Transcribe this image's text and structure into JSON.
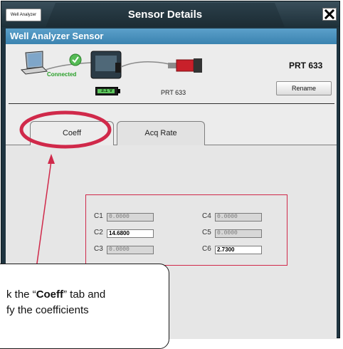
{
  "window": {
    "app_chip": "Well Analyzer",
    "title": "Sensor Details",
    "close_glyph": "✕"
  },
  "header": {
    "title": "Well Analyzer Sensor"
  },
  "devices": {
    "icons": [
      "laptop-icon",
      "check-icon",
      "analyzer-case-icon",
      "sensor-probe-icon"
    ],
    "status": "Connected",
    "battery": "3.1 V",
    "sensor_caption": "PRT 633"
  },
  "sensor": {
    "name": "PRT 633",
    "rename_label": "Rename"
  },
  "tabs": [
    {
      "label": "Coeff",
      "selected": true
    },
    {
      "label": "Acq Rate",
      "selected": false
    }
  ],
  "coefficients": [
    {
      "label": "C1",
      "value": "0.0000",
      "editable": false
    },
    {
      "label": "C2",
      "value": "14.6800",
      "editable": true
    },
    {
      "label": "C3",
      "value": "0.0000",
      "editable": false
    },
    {
      "label": "C4",
      "value": "0.0000",
      "editable": false
    },
    {
      "label": "C5",
      "value": "0.0000",
      "editable": false
    },
    {
      "label": "C6",
      "value": "2.7300",
      "editable": true
    }
  ],
  "callout": {
    "line1_pre": "k the “",
    "line1_bold": "Coeff",
    "line1_post": "” tab and",
    "line2": "fy the coefficients"
  },
  "colors": {
    "accent": "#4a93c2",
    "highlight": "#d0294a",
    "connected": "#2aa02a"
  }
}
